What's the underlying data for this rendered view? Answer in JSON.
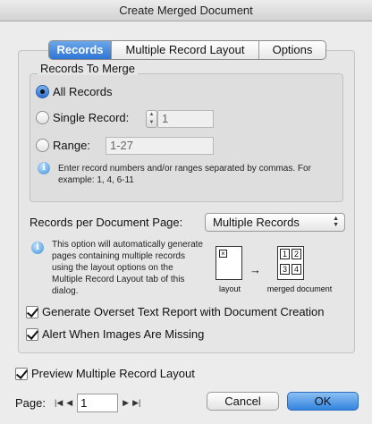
{
  "window": {
    "title": "Create Merged Document"
  },
  "tabs": [
    {
      "label": "Records",
      "active": true
    },
    {
      "label": "Multiple Record Layout",
      "active": false
    },
    {
      "label": "Options",
      "active": false
    }
  ],
  "records_to_merge": {
    "title": "Records To Merge",
    "options": {
      "all": {
        "label": "All Records",
        "selected": true
      },
      "single": {
        "label": "Single Record:",
        "value": "1",
        "selected": false
      },
      "range": {
        "label": "Range:",
        "value": "1-27",
        "selected": false
      }
    },
    "hint": "Enter record numbers and/or ranges separated by commas. For example: 1, 4, 6-11"
  },
  "records_per_page": {
    "label": "Records per Document Page:",
    "selected": "Multiple Records",
    "info": "This option will automatically generate pages containing multiple records using the layout options on the Multiple Record Layout tab of this dialog.",
    "diagram": {
      "layout_caption": "layout",
      "merged_caption": "merged document",
      "cells": [
        "1",
        "2",
        "3",
        "4"
      ]
    }
  },
  "checkboxes": {
    "overset": {
      "label": "Generate Overset Text Report with Document Creation",
      "checked": true
    },
    "images": {
      "label": "Alert When Images Are Missing",
      "checked": true
    },
    "preview": {
      "label": "Preview Multiple Record Layout",
      "checked": true
    }
  },
  "pager": {
    "label": "Page:",
    "value": "1"
  },
  "buttons": {
    "cancel": "Cancel",
    "ok": "OK"
  }
}
